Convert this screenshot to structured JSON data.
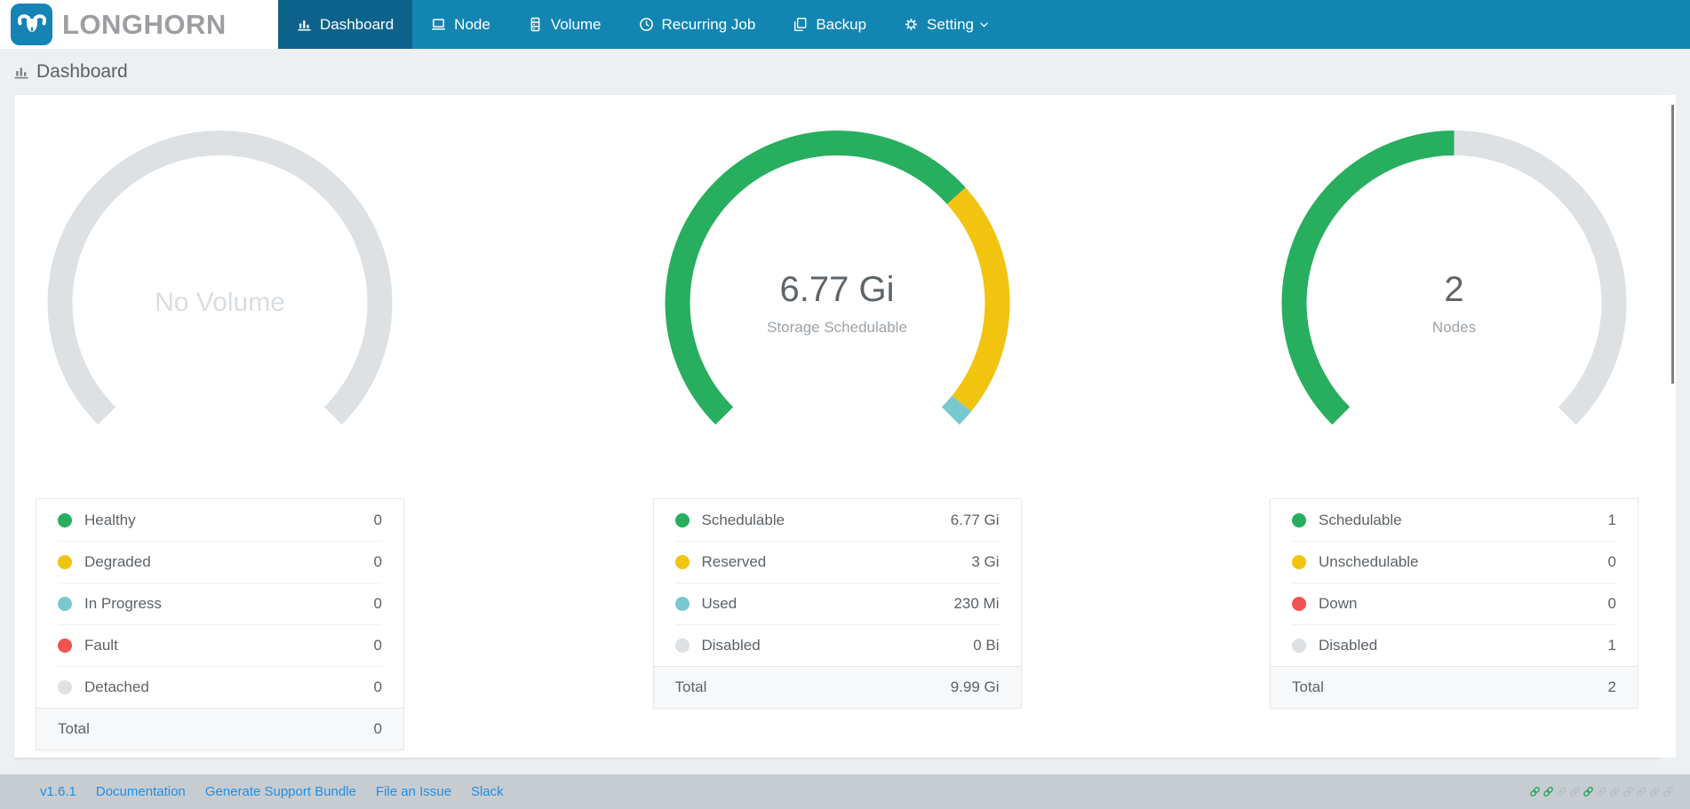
{
  "navbar": {
    "brand": "LONGHORN",
    "tabs": [
      {
        "label": "Dashboard",
        "active": true
      },
      {
        "label": "Node",
        "active": false
      },
      {
        "label": "Volume",
        "active": false
      },
      {
        "label": "Recurring Job",
        "active": false
      },
      {
        "label": "Backup",
        "active": false
      },
      {
        "label": "Setting",
        "active": false,
        "dropdown": true
      }
    ]
  },
  "page": {
    "title": "Dashboard"
  },
  "chart_data": [
    {
      "type": "gauge-donut",
      "center_label": "No Volume",
      "sub_label": "",
      "start_angle": 225,
      "sweep": 270,
      "total_value": 0,
      "segments": [
        {
          "name": "Healthy",
          "value": 0,
          "display": "0",
          "color": "#27AE5E"
        },
        {
          "name": "Degraded",
          "value": 0,
          "display": "0",
          "color": "#F1C40F"
        },
        {
          "name": "In Progress",
          "value": 0,
          "display": "0",
          "color": "#78C9CF"
        },
        {
          "name": "Fault",
          "value": 0,
          "display": "0",
          "color": "#F15354"
        },
        {
          "name": "Detached",
          "value": 0,
          "display": "0",
          "color": "#DEE1E3"
        }
      ],
      "total_row": {
        "label": "Total",
        "display": "0"
      }
    },
    {
      "type": "gauge-donut",
      "center_label": "6.77 Gi",
      "sub_label": "Storage Schedulable",
      "start_angle": 225,
      "sweep": 270,
      "total_value": 9.99,
      "segments": [
        {
          "name": "Schedulable",
          "value": 6.77,
          "display": "6.77 Gi",
          "color": "#27AE5E"
        },
        {
          "name": "Reserved",
          "value": 3,
          "display": "3 Gi",
          "color": "#F1C40F"
        },
        {
          "name": "Used",
          "value": 0.22,
          "display": "230 Mi",
          "color": "#78C9CF"
        },
        {
          "name": "Disabled",
          "value": 0,
          "display": "0 Bi",
          "color": "#DEE1E3"
        }
      ],
      "total_row": {
        "label": "Total",
        "display": "9.99 Gi"
      }
    },
    {
      "type": "gauge-donut",
      "center_label": "2",
      "sub_label": "Nodes",
      "start_angle": 225,
      "sweep": 270,
      "total_value": 2,
      "segments": [
        {
          "name": "Schedulable",
          "value": 1,
          "display": "1",
          "color": "#27AE5E"
        },
        {
          "name": "Unschedulable",
          "value": 0,
          "display": "0",
          "color": "#F1C40F"
        },
        {
          "name": "Down",
          "value": 0,
          "display": "0",
          "color": "#F15354"
        },
        {
          "name": "Disabled",
          "value": 1,
          "display": "1",
          "color": "#DEE1E3"
        }
      ],
      "total_row": {
        "label": "Total",
        "display": "2"
      }
    }
  ],
  "footer": {
    "version": "v1.6.1",
    "links": [
      "Documentation",
      "Generate Support Bundle",
      "File an Issue",
      "Slack"
    ],
    "chain_icons": [
      "green",
      "green",
      "gray",
      "gray",
      "green",
      "gray",
      "gray",
      "gray",
      "gray",
      "gray",
      "gray"
    ],
    "chain_colors": {
      "green": "#21A15C",
      "gray": "#B9BDC1"
    }
  },
  "colors": {
    "navbar": "#1385B2",
    "navbar_active": "#0D628C",
    "brand_text": "#9C9EA1",
    "page_bg": "#EDF0F2",
    "track": "#DEE1E3",
    "green": "#27AE5E",
    "yellow": "#F1C40F",
    "teal": "#78C9CF",
    "red": "#F15354",
    "footer_bg": "#C7CCD1",
    "link_blue": "#1E8FE8"
  }
}
